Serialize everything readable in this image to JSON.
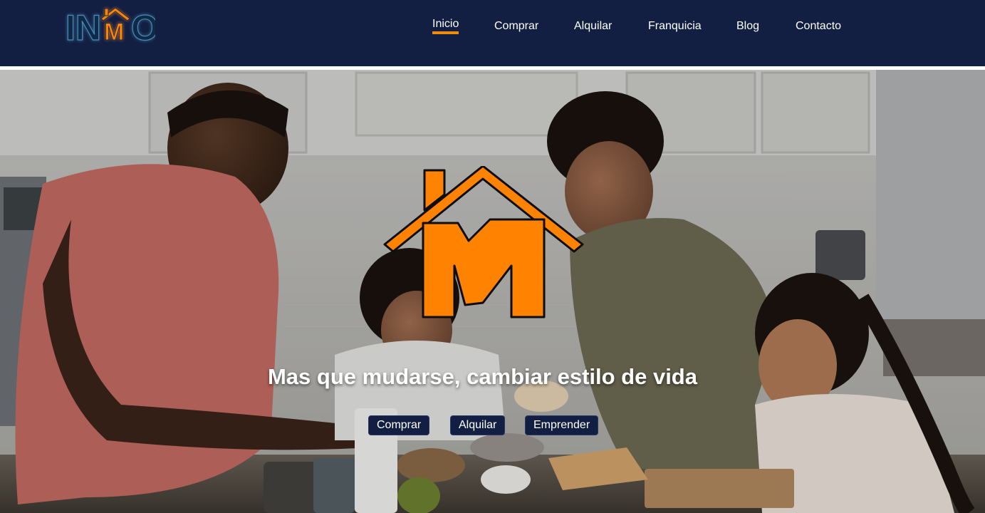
{
  "brand": {
    "logo_text_left": "IN",
    "logo_text_mid": "M",
    "logo_text_right": "O"
  },
  "nav": {
    "items": [
      {
        "label": "Inicio",
        "active": true
      },
      {
        "label": "Comprar",
        "active": false
      },
      {
        "label": "Alquilar",
        "active": false
      },
      {
        "label": "Franquicia",
        "active": false
      },
      {
        "label": "Blog",
        "active": false
      },
      {
        "label": "Contacto",
        "active": false
      }
    ]
  },
  "hero": {
    "logo_letter": "M",
    "title": "Mas que mudarse, cambiar estilo de vida",
    "buttons": [
      {
        "label": "Comprar"
      },
      {
        "label": "Alquilar"
      },
      {
        "label": "Emprender"
      }
    ]
  },
  "colors": {
    "header_bg": "#121f42",
    "accent_orange": "#f08c0a",
    "logo_orange": "#ff8200",
    "text_white": "#ffffff"
  }
}
